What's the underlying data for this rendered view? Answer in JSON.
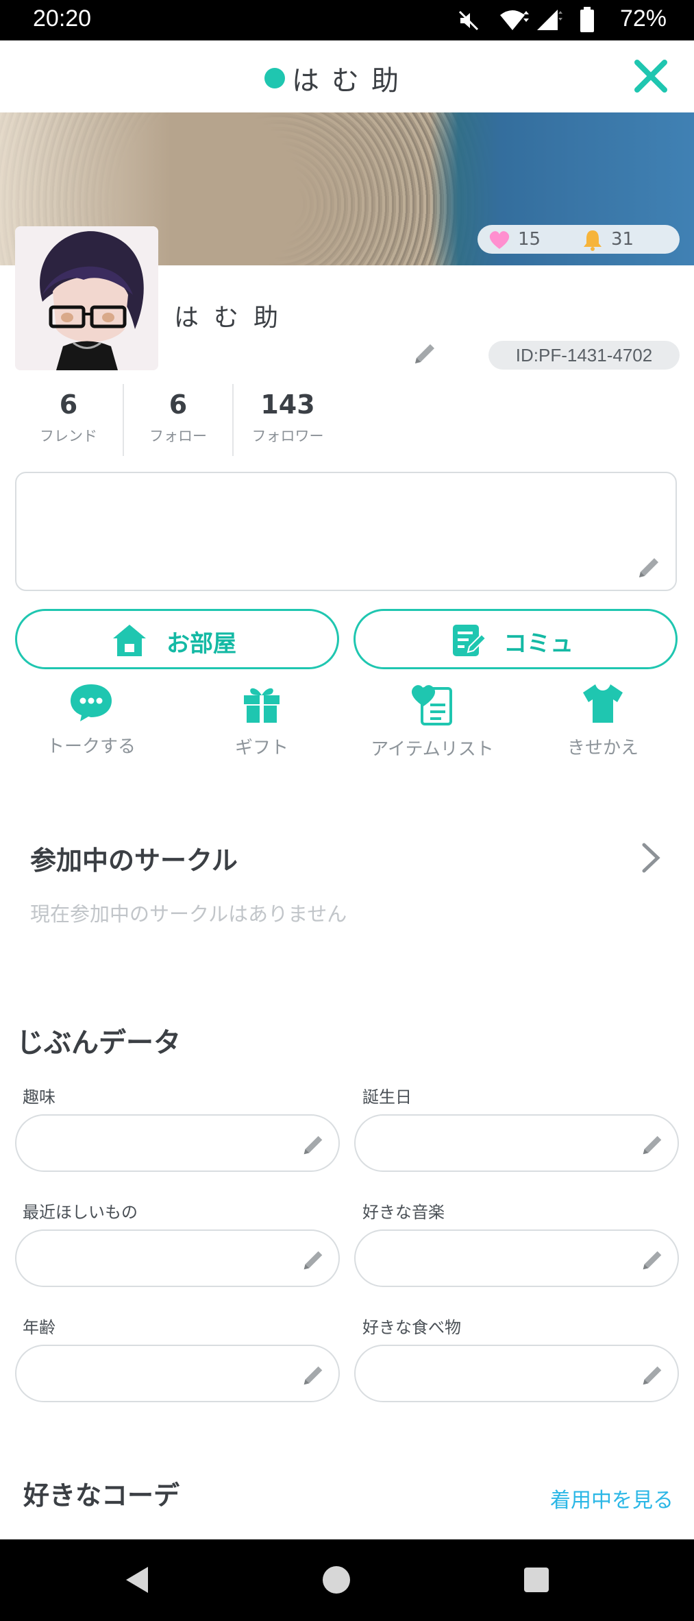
{
  "status_bar": {
    "time": "20:20",
    "battery": "72%"
  },
  "header": {
    "title": "はむ助"
  },
  "banner": {
    "likes": "15",
    "bells": "31"
  },
  "profile": {
    "name": "はむ助",
    "user_id": "ID:PF-1431-4702"
  },
  "counts": [
    {
      "value": "6",
      "label": "フレンド"
    },
    {
      "value": "6",
      "label": "フォロー"
    },
    {
      "value": "143",
      "label": "フォロワー"
    }
  ],
  "buttons": {
    "room": "お部屋",
    "community": "コミュ"
  },
  "actions": [
    {
      "label": "トークする",
      "icon": "chat-bubble-icon"
    },
    {
      "label": "ギフト",
      "icon": "gift-icon"
    },
    {
      "label": "アイテムリスト",
      "icon": "item-list-icon"
    },
    {
      "label": "きせかえ",
      "icon": "shirt-icon"
    }
  ],
  "circles": {
    "title": "参加中のサークル",
    "empty": "現在参加中のサークルはありません"
  },
  "own_data": {
    "title": "じぶんデータ",
    "fields": [
      {
        "label": "趣味",
        "value": ""
      },
      {
        "label": "誕生日",
        "value": ""
      },
      {
        "label": "最近ほしいもの",
        "value": ""
      },
      {
        "label": "好きな音楽",
        "value": ""
      },
      {
        "label": "年齢",
        "value": ""
      },
      {
        "label": "好きな食べ物",
        "value": ""
      }
    ]
  },
  "coordinate": {
    "title": "好きなコーデ",
    "link": "着用中を見る"
  },
  "colors": {
    "accent": "#1fc6b0",
    "link": "#2bb7e6"
  }
}
